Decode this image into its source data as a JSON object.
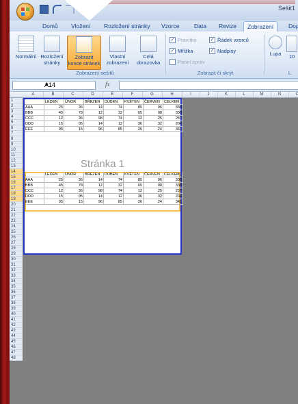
{
  "window": {
    "title": "Sešit1"
  },
  "tabs": [
    "Domů",
    "Vložení",
    "Rozložení stránky",
    "Vzorce",
    "Data",
    "Revize",
    "Zobrazení",
    "Dop"
  ],
  "active_tab": "Zobrazení",
  "ribbon": {
    "normal": "Normální",
    "layout_line1": "Rozložení",
    "layout_line2": "stránky",
    "pagebreak_line1": "Zobrazit",
    "pagebreak_line2": "konce stránek",
    "custom_line1": "Vlastní",
    "custom_line2": "zobrazení",
    "full_line1": "Celá",
    "full_line2": "obrazovka",
    "group_views": "Zobrazení sešitů",
    "ruler": "Pravítko",
    "gridlines": "Mřížka",
    "msgbar": "Panel zpráv",
    "formulabar": "Řádek vzorců",
    "headings": "Nadpisy",
    "group_show": "Zobrazit či skrýt",
    "zoom": "Lupa",
    "zoom100": "10",
    "group_zoom": "L"
  },
  "formula_bar": {
    "name_box": "A14",
    "fx": "fx",
    "value": ""
  },
  "columns": [
    "A",
    "B",
    "C",
    "D",
    "E",
    "F",
    "G",
    "H",
    "I",
    "J",
    "K",
    "L",
    "M",
    "N",
    "O"
  ],
  "rows": [
    "1",
    "2",
    "3",
    "4",
    "5",
    "6",
    "7",
    "8",
    "9",
    "10",
    "11",
    "12",
    "13",
    "14",
    "15",
    "16",
    "17",
    "18",
    "19",
    "20",
    "21",
    "22",
    "23",
    "24",
    "25",
    "26",
    "27",
    "28",
    "29",
    "30",
    "31",
    "32",
    "33",
    "34",
    "35",
    "36",
    "37",
    "38",
    "39",
    "40",
    "41",
    "42",
    "43",
    "44",
    "45",
    "46",
    "47",
    "48"
  ],
  "page_watermark": "Stránka 1",
  "table_header": [
    "",
    "LEDEN",
    "ÚNOR",
    "BŘEZEN",
    "DUBEN",
    "KVĚTEN",
    "ČERVEN",
    "CELKEM"
  ],
  "table1": [
    [
      "AAA",
      "25",
      "36",
      "14",
      "74",
      "85",
      "96",
      "330"
    ],
    [
      "BBB",
      "45",
      "78",
      "12",
      "32",
      "65",
      "98",
      "330"
    ],
    [
      "CCC",
      "12",
      "36",
      "98",
      "74",
      "12",
      "25",
      "257"
    ],
    [
      "DDD",
      "15",
      "95",
      "14",
      "12",
      "36",
      "32",
      "204"
    ],
    [
      "EEE",
      "95",
      "15",
      "96",
      "85",
      "26",
      "24",
      "341"
    ]
  ],
  "table2": [
    [
      "AAA",
      "25",
      "36",
      "14",
      "74",
      "85",
      "96",
      "330"
    ],
    [
      "BBB",
      "45",
      "78",
      "12",
      "32",
      "65",
      "98",
      "330"
    ],
    [
      "CCC",
      "12",
      "36",
      "98",
      "74",
      "12",
      "25",
      "257"
    ],
    [
      "DDD",
      "15",
      "95",
      "14",
      "12",
      "36",
      "32",
      "204"
    ],
    [
      "EEE",
      "95",
      "15",
      "96",
      "85",
      "26",
      "24",
      "341"
    ]
  ]
}
